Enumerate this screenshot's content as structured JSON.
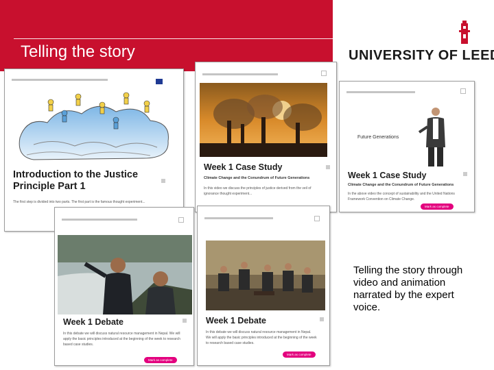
{
  "slide": {
    "title": "Telling the story"
  },
  "logo": {
    "text": "UNIVERSITY OF LEEDS"
  },
  "caption": "Telling the story through video and animation narrated by the expert voice.",
  "cards": {
    "justice": {
      "title": "Introduction to the Justice Principle Part 1",
      "body": "The first step is divided into two parts. The first part is the famous thought experiment..."
    },
    "case1": {
      "title": "Week 1 Case Study",
      "subtitle": "Climate Change and the Conundrum of Future Generations",
      "body": "In this video we discuss the principles of justice derived from the veil of ignorance thought experiment..."
    },
    "case2": {
      "title": "Week 1 Case Study",
      "video_label": "Future Generations",
      "subtitle": "Climate Change and the Conundrum of Future Generations",
      "body": "In the above video the concept of sustainability and the United Nations Framework Convention on Climate Change.",
      "cta": "Mark as complete"
    },
    "debate1": {
      "title": "Week 1 Debate",
      "body": "In this debate we will discuss natural resource management in Nepal. We will apply the basic principles introduced at the beginning of the week to research based case studies.",
      "cta": "Mark as complete"
    },
    "debate2": {
      "title": "Week 1 Debate",
      "body": "In this debate we will discuss natural resource management in Nepal. We will apply the basic principles introduced at the beginning of the week to research based case studies.",
      "cta": "Mark as complete"
    }
  },
  "colors": {
    "brand_red": "#c8102e",
    "cta_pink": "#e3007e"
  }
}
